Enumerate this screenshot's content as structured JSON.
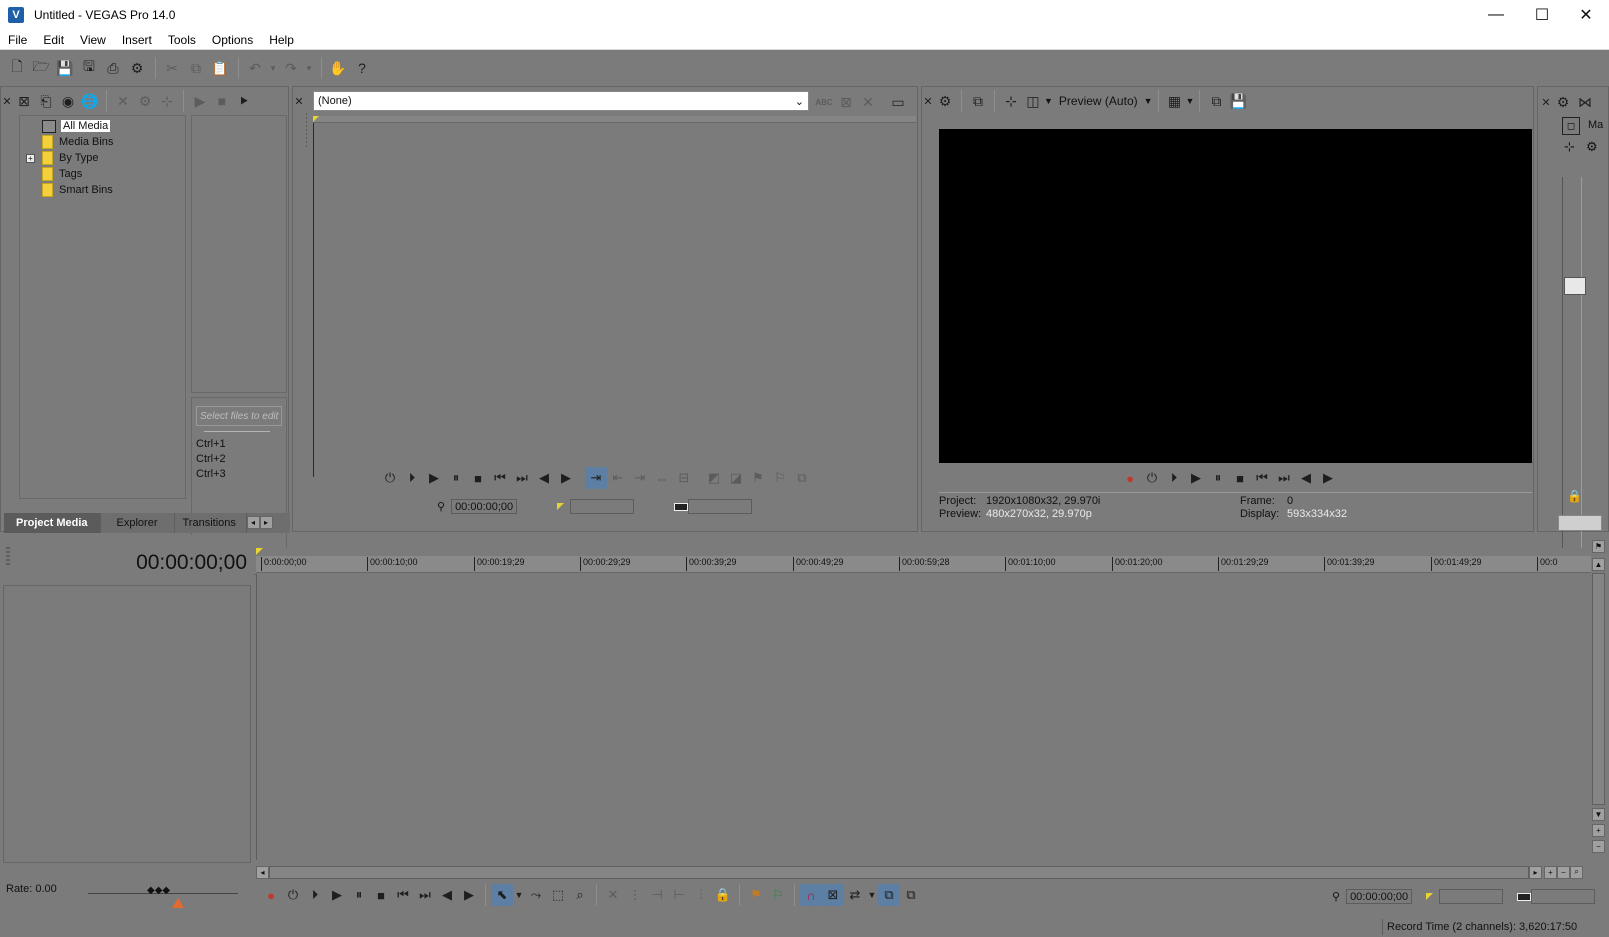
{
  "window": {
    "title": "Untitled - VEGAS Pro 14.0",
    "logo": "V",
    "minimize": "—",
    "maximize": "☐",
    "close": "✕"
  },
  "menu": [
    "File",
    "Edit",
    "View",
    "Insert",
    "Tools",
    "Options",
    "Help"
  ],
  "project_media": {
    "tree": [
      {
        "label": "All Media",
        "selected": true
      },
      {
        "label": "Media Bins"
      },
      {
        "label": "By Type",
        "expandable": true,
        "expander": "+"
      },
      {
        "label": "Tags"
      },
      {
        "label": "Smart Bins"
      }
    ],
    "search_placeholder": "Select files to edit",
    "shortcuts": [
      "Ctrl+1",
      "Ctrl+2",
      "Ctrl+3"
    ],
    "tabs": [
      "Project Media",
      "Explorer",
      "Transitions"
    ],
    "active_tab": "Project Media",
    "tab_nav": {
      "prev": "◂",
      "next": "▸"
    }
  },
  "trimmer": {
    "dropdown_value": "(None)",
    "dropdown_arrow": "⌄",
    "abc_label": "ABC",
    "timecode": "00:00:00;00"
  },
  "preview": {
    "mode_label": "Preview (Auto)",
    "project_label": "Project:",
    "project_value": "1920x1080x32, 29.970i",
    "preview_label": "Preview:",
    "preview_value": "480x270x32, 29.970p",
    "frame_label": "Frame:",
    "frame_value": "0",
    "display_label": "Display:",
    "display_value": "593x334x32"
  },
  "master_bus": {
    "label": "Ma"
  },
  "timeline": {
    "main_timecode": "00:00:00;00",
    "ruler_ticks": [
      "0:00:00;00",
      "00:00:10;00",
      "00:00:19;29",
      "00:00:29;29",
      "00:00:39;29",
      "00:00:49;29",
      "00:00:59;28",
      "00:01:10;00",
      "00:01:20;00",
      "00:01:29;29",
      "00:01:39;29",
      "00:01:49;29",
      "00:0"
    ],
    "rate_label": "Rate: 0.00",
    "cursor_timecode": "00:00:00;00",
    "status": "Record Time (2 channels): 3,620:17:50"
  }
}
